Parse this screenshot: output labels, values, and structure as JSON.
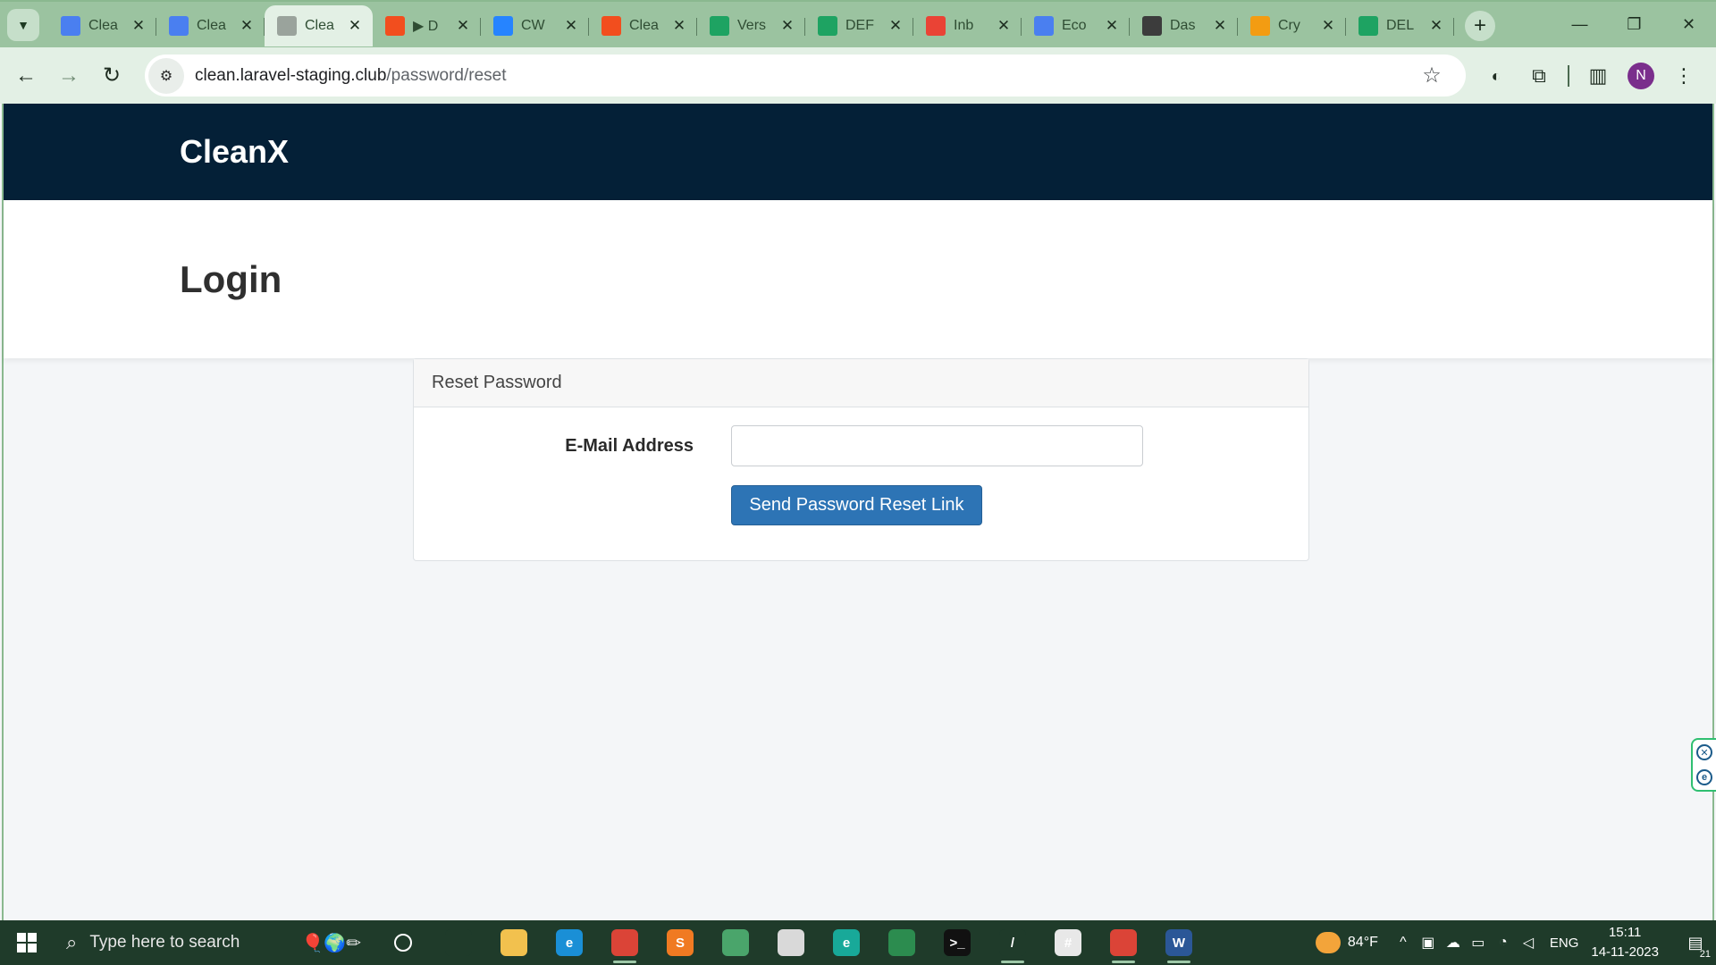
{
  "browser": {
    "tabs": [
      {
        "title": "Clea",
        "icon": "docs-icon",
        "color": "#4a7ff0",
        "active": false
      },
      {
        "title": "Clea",
        "icon": "docs-icon",
        "color": "#4a7ff0",
        "active": false
      },
      {
        "title": "Clea",
        "icon": "globe-icon",
        "color": "#9aa39c",
        "active": true
      },
      {
        "title": "▶ D",
        "icon": "figma-icon",
        "color": "#f24e1e",
        "active": false
      },
      {
        "title": "CW",
        "icon": "jira-icon",
        "color": "#2684ff",
        "active": false
      },
      {
        "title": "Clea",
        "icon": "figma-icon",
        "color": "#f24e1e",
        "active": false
      },
      {
        "title": "Vers",
        "icon": "sheets-icon",
        "color": "#1ea362",
        "active": false
      },
      {
        "title": "DEF",
        "icon": "sheets-icon",
        "color": "#1ea362",
        "active": false
      },
      {
        "title": "Inb",
        "icon": "gmail-icon",
        "color": "#ea4335",
        "active": false
      },
      {
        "title": "Eco",
        "icon": "docs-icon",
        "color": "#4a7ff0",
        "active": false
      },
      {
        "title": "Das",
        "icon": "wordpress-icon",
        "color": "#3c3c3c",
        "active": false
      },
      {
        "title": "Cry",
        "icon": "crypto-icon",
        "color": "#f39c12",
        "active": false
      },
      {
        "title": "DEL",
        "icon": "sheets-icon",
        "color": "#1ea362",
        "active": false
      }
    ],
    "url_host": "clean.laravel-staging.club",
    "url_path": "/password/reset",
    "profile_initial": "N"
  },
  "page": {
    "brand": "CleanX",
    "title": "Login",
    "card_header": "Reset Password",
    "email_label": "E-Mail Address",
    "email_value": "",
    "submit_label": "Send Password Reset Link"
  },
  "taskbar": {
    "search_placeholder": "Type here to search",
    "temperature": "84°F",
    "language": "ENG",
    "time": "15:11",
    "date": "14-11-2023",
    "notifications": "21",
    "apps": [
      {
        "name": "task-view-icon",
        "label": "",
        "color": "#1f3b2a",
        "open": false
      },
      {
        "name": "file-explorer-icon",
        "label": "",
        "color": "#f2c14e",
        "open": false
      },
      {
        "name": "edge-icon",
        "label": "e",
        "color": "#1a8fd6",
        "open": false
      },
      {
        "name": "chrome-icon",
        "label": "",
        "color": "#db4437",
        "open": true
      },
      {
        "name": "sublime-icon",
        "label": "S",
        "color": "#f07a22",
        "open": false
      },
      {
        "name": "notepad-icon",
        "label": "",
        "color": "#4aa56b",
        "open": false
      },
      {
        "name": "paint-icon",
        "label": "",
        "color": "#d9d9d9",
        "open": false
      },
      {
        "name": "edge-dev-icon",
        "label": "e",
        "color": "#18a999",
        "open": false
      },
      {
        "name": "meet-icon",
        "label": "",
        "color": "#2c8c4f",
        "open": false
      },
      {
        "name": "terminal-icon",
        "label": ">_",
        "color": "#111111",
        "open": false
      },
      {
        "name": "pen-icon",
        "label": "/",
        "color": "#1f3b2a",
        "open": true
      },
      {
        "name": "slack-icon",
        "label": "#",
        "color": "#e8e8e8",
        "open": false
      },
      {
        "name": "chrome-profile-icon",
        "label": "",
        "color": "#db4437",
        "open": true
      },
      {
        "name": "word-icon",
        "label": "W",
        "color": "#2b5797",
        "open": true
      }
    ]
  }
}
